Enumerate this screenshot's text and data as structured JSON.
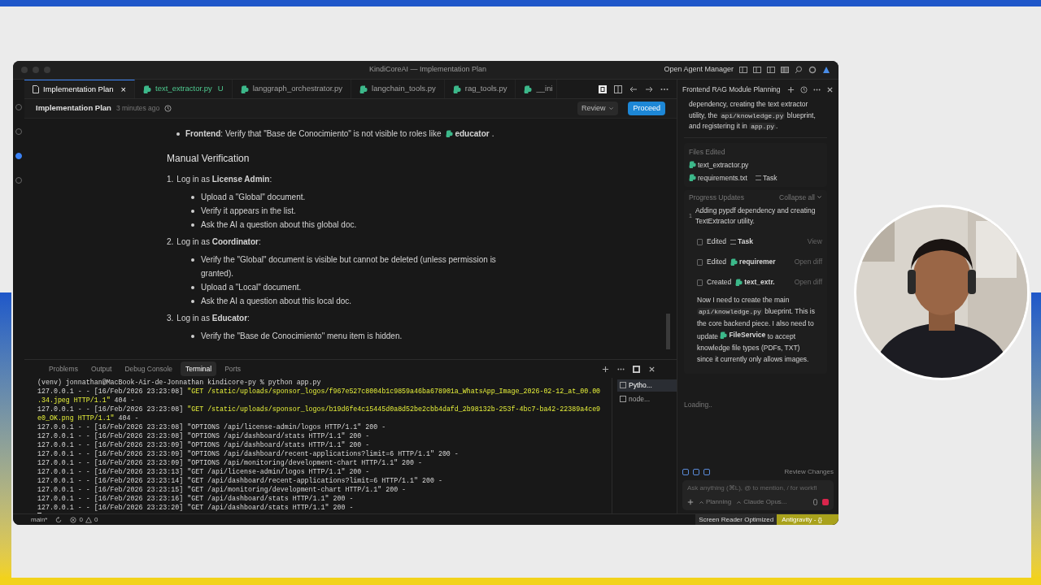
{
  "window": {
    "title": "KindiCoreAI — Implementation Plan",
    "agent_manager": "Open Agent Manager"
  },
  "tabs": [
    {
      "label": "Implementation Plan",
      "kind": "doc",
      "selected": true,
      "close": "×"
    },
    {
      "label": "text_extractor.py",
      "kind": "py",
      "selected": false,
      "badge": "U",
      "modified": true
    },
    {
      "label": "langgraph_orchestrator.py",
      "kind": "py",
      "selected": false
    },
    {
      "label": "langchain_tools.py",
      "kind": "py",
      "selected": false
    },
    {
      "label": "rag_tools.py",
      "kind": "py",
      "selected": false
    },
    {
      "label": "__ini",
      "kind": "py",
      "selected": false
    }
  ],
  "editor_header": {
    "title": "Implementation Plan",
    "time": "3 minutes ago",
    "review": "Review",
    "proceed": "Proceed"
  },
  "plan": {
    "bullets": [
      {
        "text": "**Frontend**: Verify that \"Base de Conocimiento\" is not visible to roles like",
        "chip": "educator",
        "end": "."
      }
    ],
    "heading": "Manual Verification",
    "steps": [
      {
        "number": "1.",
        "text": "Log in as **License Admin**:",
        "items": [
          "Upload a \"Global\" document.",
          "Verify it appears in the list.",
          "Ask the AI a question about this global doc."
        ]
      },
      {
        "number": "2.",
        "text": "Log in as **Coordinator**:",
        "items": [
          "Verify the \"Global\" document is visible but cannot be deleted (unless permission is granted).",
          "Upload a \"Local\" document.",
          "Ask the AI a question about this local doc."
        ]
      },
      {
        "number": "3.",
        "text": "Log in as **Educator**:",
        "items": [
          "Verify the \"Base de Conocimiento\" menu item is hidden."
        ]
      }
    ]
  },
  "panel_tabs": [
    {
      "label": "Problems",
      "selected": false
    },
    {
      "label": "Output",
      "selected": false
    },
    {
      "label": "Debug Console",
      "selected": false
    },
    {
      "label": "Terminal",
      "selected": true
    },
    {
      "label": "Ports",
      "selected": false
    }
  ],
  "terminal": {
    "lines": [
      [
        {
          "t": "(venv) jonnathan@MacBook-Air-de-Jonnathan kindicore-py % python app.py"
        }
      ],
      [
        {
          "t": "127.0.0.1 - - [16/Feb/2026 23:23:08] "
        },
        {
          "t": "\"GET /static/uploads/sponsor_logos/f967e527c8004b1c9859a46ba678901a_WhatsApp_Image_2026-02-12_at_00.00",
          "hl": true
        }
      ],
      [
        {
          "t": ".34.jpeg HTTP/1.1\"",
          "hl": true
        },
        {
          "t": " 404 -"
        }
      ],
      [
        {
          "t": "127.0.0.1 - - [16/Feb/2026 23:23:08] "
        },
        {
          "t": "\"GET /static/uploads/sponsor_logos/b19d6fe4c15445d0a8d52be2cbb4dafd_2b98132b-253f-4bc7-ba42-22389a4ce9",
          "hl": true
        }
      ],
      [
        {
          "t": "e0_OK.png HTTP/1.1\"",
          "hl": true
        },
        {
          "t": " 404 -"
        }
      ],
      [
        {
          "t": "127.0.0.1 - - [16/Feb/2026 23:23:08] \"OPTIONS /api/license-admin/logos HTTP/1.1\" 200 -"
        }
      ],
      [
        {
          "t": "127.0.0.1 - - [16/Feb/2026 23:23:08] \"OPTIONS /api/dashboard/stats HTTP/1.1\" 200 -"
        }
      ],
      [
        {
          "t": "127.0.0.1 - - [16/Feb/2026 23:23:09] \"OPTIONS /api/dashboard/stats HTTP/1.1\" 200 -"
        }
      ],
      [
        {
          "t": "127.0.0.1 - - [16/Feb/2026 23:23:09] \"OPTIONS /api/dashboard/recent-applications?limit=6 HTTP/1.1\" 200 -"
        }
      ],
      [
        {
          "t": "127.0.0.1 - - [16/Feb/2026 23:23:09] \"OPTIONS /api/monitoring/development-chart HTTP/1.1\" 200 -"
        }
      ],
      [
        {
          "t": "127.0.0.1 - - [16/Feb/2026 23:23:13] \"GET /api/license-admin/logos HTTP/1.1\" 200 -"
        }
      ],
      [
        {
          "t": "127.0.0.1 - - [16/Feb/2026 23:23:14] \"GET /api/dashboard/recent-applications?limit=6 HTTP/1.1\" 200 -"
        }
      ],
      [
        {
          "t": "127.0.0.1 - - [16/Feb/2026 23:23:15] \"GET /api/monitoring/development-chart HTTP/1.1\" 200 -"
        }
      ],
      [
        {
          "t": "127.0.0.1 - - [16/Feb/2026 23:23:16] \"GET /api/dashboard/stats HTTP/1.1\" 200 -"
        }
      ],
      [
        {
          "t": "127.0.0.1 - - [16/Feb/2026 23:23:20] \"GET /api/dashboard/stats HTTP/1.1\" 200 -"
        }
      ]
    ],
    "sessions": [
      {
        "label": "Pytho...",
        "selected": true
      },
      {
        "label": "node...",
        "selected": false
      }
    ]
  },
  "agent": {
    "title": "Frontend RAG Module Planning",
    "summary": [
      {
        "t": "dependency, creating the text extractor utility, the "
      },
      {
        "t": "api/knowledge.py",
        "code": true
      },
      {
        "t": " blueprint, and registering it in "
      },
      {
        "t": "app.py",
        "code": true
      },
      {
        "t": "."
      }
    ],
    "files_heading": "Files Edited",
    "files": [
      {
        "name": "text_extractor.py"
      },
      {
        "name": "requirements.txt",
        "extra": "Task"
      }
    ],
    "progress_heading": "Progress Updates",
    "collapse": "Collapse all",
    "step": {
      "number": "1",
      "text": "Adding pypdf dependency and creating TextExtractor utility."
    },
    "actions": [
      {
        "verb": "Edited",
        "kind": "task",
        "target": "Task",
        "link": "View"
      },
      {
        "verb": "Edited",
        "kind": "py",
        "target": "requiremer",
        "link": "Open diff"
      },
      {
        "verb": "Created",
        "kind": "py",
        "target": "text_extr.",
        "link": "Open diff"
      }
    ],
    "message": [
      {
        "t": "Now I need to create the main "
      },
      {
        "t": "api/knowledge.py",
        "code": true
      },
      {
        "t": " blueprint. This is the core backend piece. I also need to update "
      },
      {
        "t": "FileService",
        "chip": true
      },
      {
        "t": " to accept knowledge file types (PDFs, TXT) since it currently only allows images."
      }
    ],
    "loading": "Loading..",
    "review_changes": "Review Changes",
    "input": {
      "placeholder": "Ask anything (⌘L), @ to mention, / for workfl"
    },
    "mode": "Planning",
    "model": "Claude Opus..."
  },
  "status_bar": {
    "branch": "main*",
    "errors": "0",
    "warnings": "0",
    "screen_reader": "Screen Reader Optimized",
    "antigravity": "Antigravity - {}"
  }
}
